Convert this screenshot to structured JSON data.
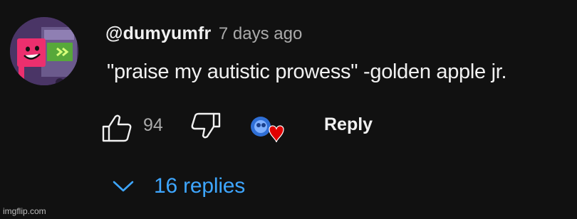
{
  "comment": {
    "author": "@dumyumfr",
    "timestamp": "7 days ago",
    "text": "\"praise my autistic prowess\" -golden apple jr.",
    "like_count": "94",
    "reply_label": "Reply",
    "replies_label": "16 replies",
    "liked_by_creator": true
  },
  "icons": {
    "like": "thumbs-up-icon",
    "dislike": "thumbs-down-icon",
    "heart": "creator-heart-icon",
    "expand": "chevron-down-icon"
  },
  "colors": {
    "background": "#111111",
    "text": "#f1f1f1",
    "secondary_text": "#aaaaaa",
    "link": "#3ea6ff",
    "heart": "#e00000"
  },
  "watermark": "imgflip.com"
}
